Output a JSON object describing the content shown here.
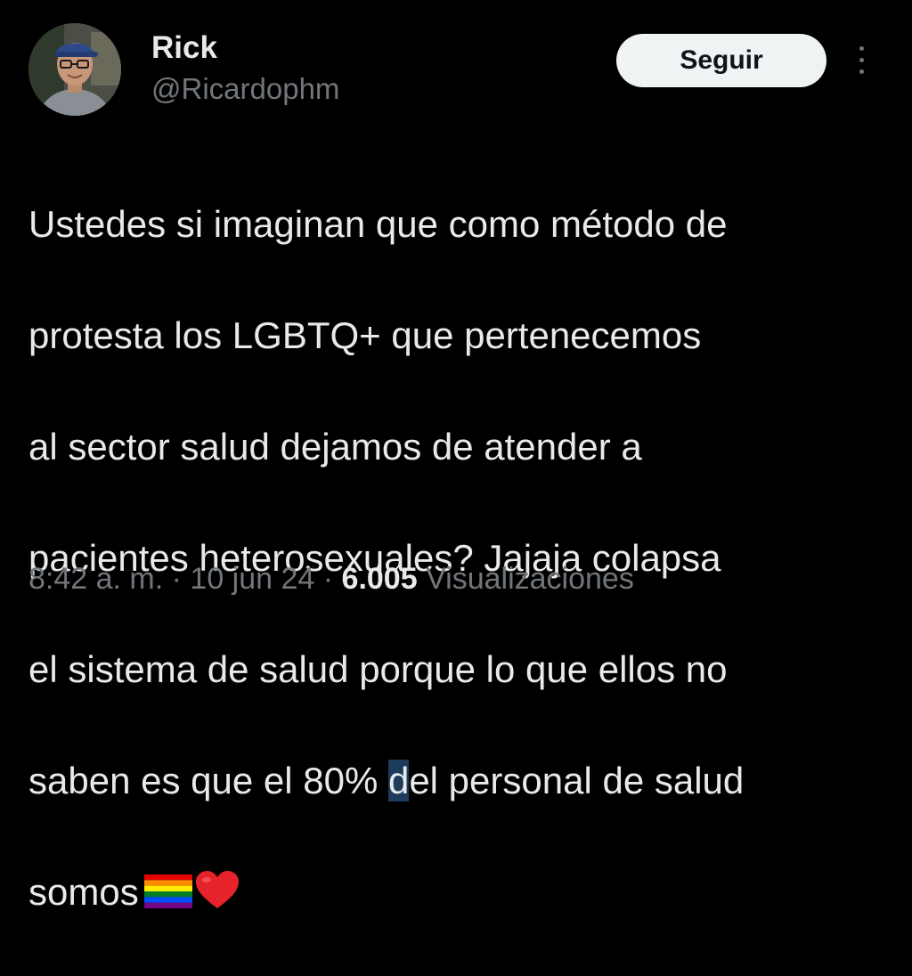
{
  "author": {
    "display_name": "Rick",
    "handle": "@Ricardophm",
    "avatar": "profile-photo"
  },
  "follow_button": {
    "label": "Seguir"
  },
  "more_menu": {
    "icon": "more-vertical-icon"
  },
  "tweet": {
    "lines": [
      "Ustedes si imaginan que como método de",
      "protesta los LGBTQ+ que pertenecemos",
      "al sector salud dejamos de atender a",
      "pacientes heterosexuales? Jajaja colapsa",
      "el sistema de salud porque lo que ellos no"
    ],
    "line6_before": "saben es que el 80% ",
    "line6_selected": "d",
    "line6_after": "el personal de salud",
    "line7": "somos",
    "emojis": [
      "rainbow-flag-icon",
      "red-heart-icon"
    ]
  },
  "meta": {
    "time": "8:42 a. m.",
    "separator": " · ",
    "date": "10 jun 24",
    "views_count": "6.005",
    "views_label": "Visualizaciones"
  },
  "colors": {
    "background": "#000000",
    "text_primary": "#e7e9ea",
    "text_secondary": "#71767b",
    "button_bg": "#eff3f4",
    "button_text": "#0f1419",
    "selection": "#1d3b5a"
  }
}
